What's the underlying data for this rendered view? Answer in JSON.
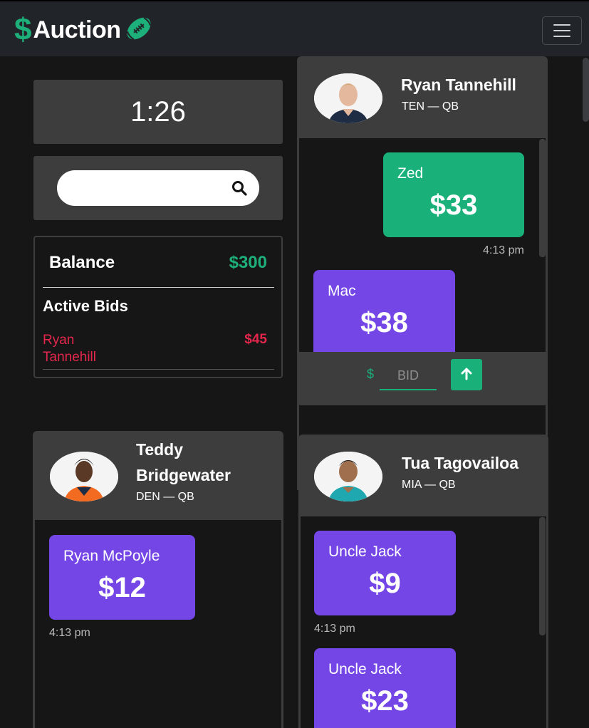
{
  "nav": {
    "dollar": "$",
    "brand": "Auction",
    "brand_color": "#1db07a",
    "menu_icon": "hamburger-icon"
  },
  "timer": "1:26",
  "search": {
    "placeholder": "",
    "icon": "search-icon"
  },
  "balance": {
    "label": "Balance",
    "value": "$300",
    "active_title": "Active Bids",
    "active_bids": [
      {
        "name": "Ryan Tannehill",
        "amount": "$45"
      }
    ]
  },
  "players": [
    {
      "name": "Ryan Tannehill",
      "team_pos": "TEN — QB",
      "bids": [
        {
          "bidder": "Zed",
          "amount": "$33",
          "time": "4:13 pm",
          "color": "#19b07a"
        },
        {
          "bidder": "Mac",
          "amount": "$38",
          "color": "#7446e6"
        }
      ],
      "bid_input": {
        "currency": "$",
        "placeholder": "BID",
        "submit_icon": "arrow-up-icon"
      }
    },
    {
      "name_line1": "Teddy",
      "name_line2": "Bridgewater",
      "team_pos": "DEN — QB",
      "bids": [
        {
          "bidder": "Ryan McPoyle",
          "amount": "$12",
          "time": "4:13 pm",
          "color": "#7446e6"
        }
      ]
    },
    {
      "name": "Tua Tagovailoa",
      "team_pos": "MIA — QB",
      "bids": [
        {
          "bidder": "Uncle Jack",
          "amount": "$9",
          "time": "4:13 pm",
          "color": "#7446e6"
        },
        {
          "bidder": "Uncle Jack",
          "amount": "$23",
          "color": "#7446e6"
        }
      ]
    }
  ]
}
